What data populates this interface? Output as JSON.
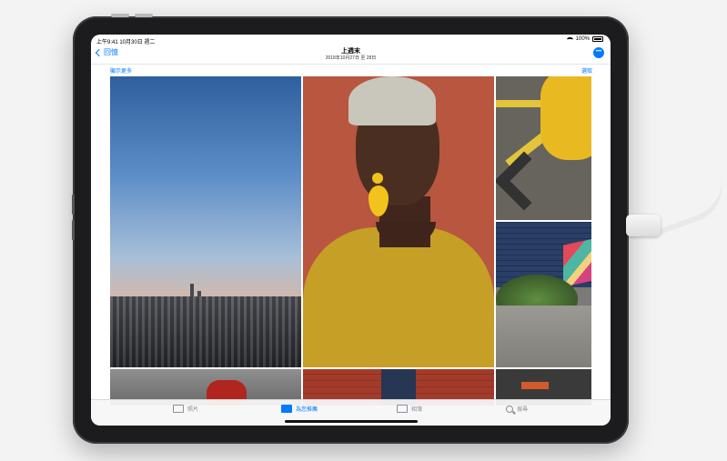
{
  "status": {
    "time": "上午9:41 10月30日 週二",
    "battery": "100%"
  },
  "nav": {
    "back_label": "回憶",
    "title": "上週末",
    "subtitle": "2018年10月27日 至 28日",
    "more_glyph": "•••"
  },
  "subbar": {
    "show_more": "顯示更多",
    "select": "選取"
  },
  "tabs": [
    {
      "label": "照片"
    },
    {
      "label": "為您推薦"
    },
    {
      "label": "相簿"
    },
    {
      "label": "搜尋"
    }
  ],
  "active_tab": "為您推薦",
  "colors": {
    "accent": "#007aff",
    "device": "#1c1c1e"
  }
}
